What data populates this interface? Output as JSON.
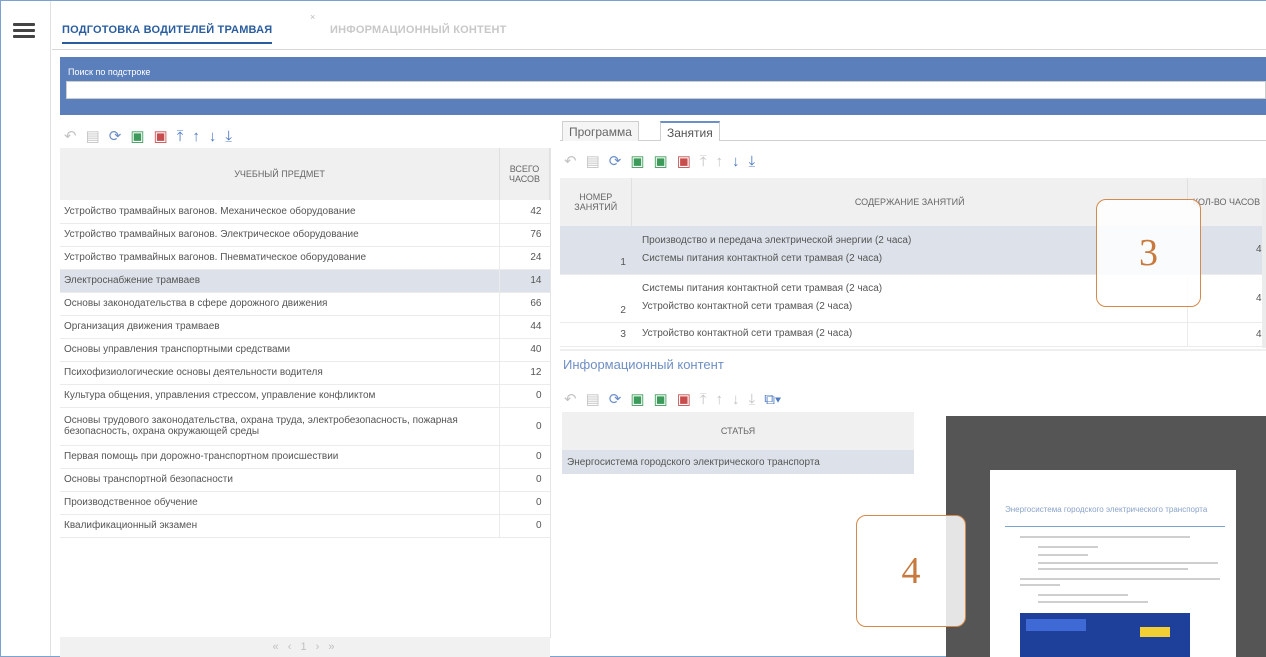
{
  "tabs": [
    {
      "label": "ПОДГОТОВКА ВОДИТЕЛЕЙ ТРАМВАЯ"
    },
    {
      "label": "ИНФОРМАЦИОННЫЙ КОНТЕНТ"
    }
  ],
  "search": {
    "label": "Поиск по подстроке",
    "value": ""
  },
  "subjects": {
    "headers": {
      "subject": "УЧЕБНЫЙ ПРЕДМЕТ",
      "hours": "ВСЕГО ЧАСОВ"
    },
    "rows": [
      {
        "name": "Устройство трамвайных вагонов. Механическое оборудование",
        "hours": "42"
      },
      {
        "name": "Устройство трамвайных вагонов. Электрическое оборудование",
        "hours": "76"
      },
      {
        "name": "Устройство трамвайных вагонов. Пневматическое оборудование",
        "hours": "24"
      },
      {
        "name": "Электроснабжение трамваев",
        "hours": "14"
      },
      {
        "name": "Основы законодательства в сфере дорожного движения",
        "hours": "66"
      },
      {
        "name": "Организация движения трамваев",
        "hours": "44"
      },
      {
        "name": "Основы управления транспортными средствами",
        "hours": "40"
      },
      {
        "name": "Психофизиологические основы деятельности водителя",
        "hours": "12"
      },
      {
        "name": "Культура общения, управления стрессом, управление конфликтом",
        "hours": "0"
      },
      {
        "name": "Основы трудового законодательства, охрана труда, электробезопасность, пожарная безопасность, охрана окружающей среды",
        "hours": "0"
      },
      {
        "name": "Первая помощь при дорожно-транспортном происшествии",
        "hours": "0"
      },
      {
        "name": "Основы транспортной безопасности",
        "hours": "0"
      },
      {
        "name": "Производственное обучение",
        "hours": "0"
      },
      {
        "name": "Квалификационный экзамен",
        "hours": "0"
      }
    ],
    "pager": "« ‹ 1 › »"
  },
  "subtabs": [
    {
      "label": "Программа"
    },
    {
      "label": "Занятия"
    }
  ],
  "lessons": {
    "headers": {
      "num": "НОМЕР ЗАНЯТИЙ",
      "content": "СОДЕРЖАНИЕ ЗАНЯТИЙ",
      "hours": "КОЛ-ВО ЧАСОВ"
    },
    "rows": [
      {
        "num": "1",
        "lines": [
          "Производство и передача электрической энергии (2 часа)",
          "Системы питания контактной сети трамвая (2 часа)"
        ],
        "hours": "4"
      },
      {
        "num": "2",
        "lines": [
          "Системы питания контактной сети трамвая (2 часа)",
          "Устройство контактной сети трамвая (2 часа)"
        ],
        "hours": "4"
      },
      {
        "num": "3",
        "lines": [
          "Устройство контактной сети трамвая (2 часа)"
        ],
        "hours": "4"
      }
    ]
  },
  "info": {
    "title": "Информационный контент",
    "article_header": "СТАТЬЯ",
    "article": "Энергосистема городского электрического транспорта",
    "preview_title": "Энергосистема городского электрического транспорта"
  },
  "callouts": {
    "c3": "3",
    "c4": "4"
  },
  "colors": {
    "accent": "#2a5d9f",
    "searchbar": "#5b7fba",
    "callout": "#d5894a",
    "selected_row": "#dde2ea"
  }
}
